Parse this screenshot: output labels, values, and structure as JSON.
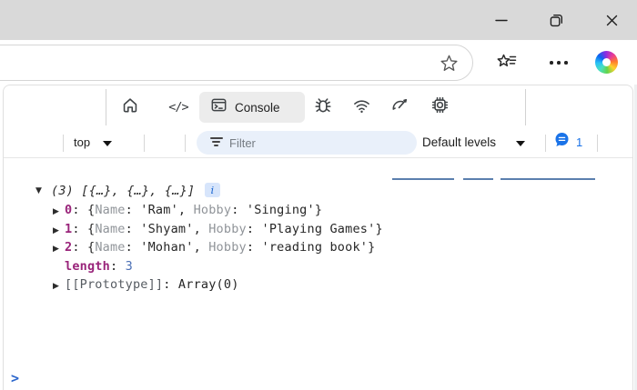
{
  "browser": {
    "sources_icon_glyph": "</>"
  },
  "devtools": {
    "tabbar": {
      "console_label": "Console"
    },
    "toolbar": {
      "context_label": "top",
      "filter_placeholder": "Filter",
      "levels_label": "Default levels",
      "issues_count": "1"
    },
    "console": {
      "summary": "(3) [{…}, {…}, {…}]",
      "info_badge": "i",
      "punct": {
        "colon": ": ",
        "comma": ", ",
        "brace_open": "{",
        "brace_close": "}",
        "expand_closed": "▶",
        "expand_open": "▼",
        "prompt": ">"
      },
      "rows": [
        {
          "index": "0",
          "pairs": [
            {
              "key": "Name",
              "value": "'Ram'"
            },
            {
              "key": "Hobby",
              "value": "'Singing'"
            }
          ]
        },
        {
          "index": "1",
          "pairs": [
            {
              "key": "Name",
              "value": "'Shyam'"
            },
            {
              "key": "Hobby",
              "value": "'Playing Games'"
            }
          ]
        },
        {
          "index": "2",
          "pairs": [
            {
              "key": "Name",
              "value": "'Mohan'"
            },
            {
              "key": "Hobby",
              "value": "'reading book'"
            }
          ]
        }
      ],
      "length_label": "length",
      "length_value": "3",
      "prototype_label": "[[Prototype]]",
      "prototype_value": "Array(0)"
    }
  },
  "colors": {
    "accent_blue": "#1a73e8",
    "index_purple": "#99247a",
    "number_blue": "#4a6fb5",
    "key_gray": "#909499",
    "link_underline_blue": "#5b7fae",
    "titlebar_gray": "#d9d9d9"
  }
}
